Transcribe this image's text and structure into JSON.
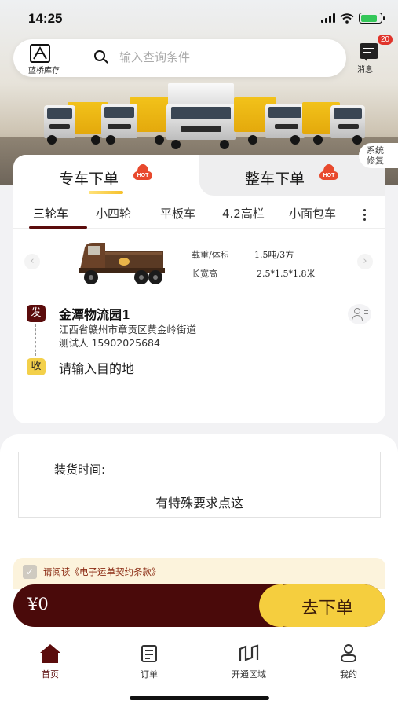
{
  "status_bar": {
    "time": "14:25"
  },
  "header": {
    "logo_label": "蓝桥库存",
    "search_placeholder": "输入查询条件",
    "messages": {
      "label": "消息",
      "badge": "20"
    },
    "system_fix": "系统\n修复"
  },
  "order_tabs": [
    {
      "label": "专车下单",
      "hot": "HOT",
      "active": true
    },
    {
      "label": "整车下单",
      "hot": "HOT",
      "active": false
    }
  ],
  "vehicle_tabs": [
    "三轮车",
    "小四轮",
    "平板车",
    "4.2高栏",
    "小面包车"
  ],
  "vehicle": {
    "specs": [
      {
        "key": "载重/体积",
        "value": "1.5吨/3方"
      },
      {
        "key": "长宽高",
        "value": "2.5*1.5*1.8米"
      }
    ]
  },
  "route": {
    "from_badge": "发",
    "from_name": "金潭物流园1",
    "from_address": "江西省赣州市章贡区黄金岭街道",
    "from_contact": "测试人 15902025684",
    "to_badge": "收",
    "to_placeholder": "请输入目的地"
  },
  "form": {
    "loading_time_label": "装货时间:",
    "special_requirements": "有特殊要求点这"
  },
  "agreement": {
    "checked": true,
    "text": "请阅读《电子运单契约条款》"
  },
  "checkout": {
    "price": "¥0",
    "submit_label": "去下单"
  },
  "bottom_nav": [
    {
      "label": "首页",
      "icon": "home-icon",
      "active": true
    },
    {
      "label": "订单",
      "icon": "order-icon",
      "active": false
    },
    {
      "label": "开通区域",
      "icon": "area-icon",
      "active": false
    },
    {
      "label": "我的",
      "icon": "profile-icon",
      "active": false
    }
  ],
  "colors": {
    "brand": "#5b0c0c",
    "accent": "#f5ce3e",
    "hot": "#e8492d"
  }
}
